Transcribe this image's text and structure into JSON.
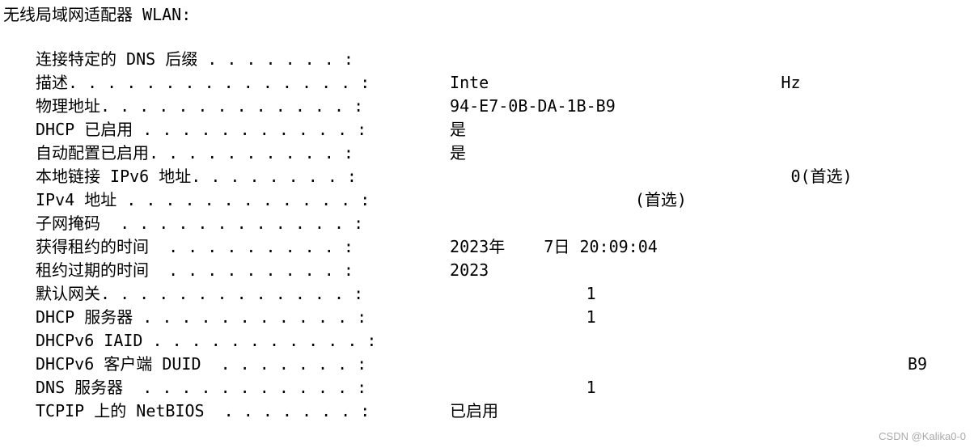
{
  "header": "无线局域网适配器 WLAN:",
  "rows": [
    {
      "label": "连接特定的 DNS 后缀 . . . . . . . :",
      "value": ""
    },
    {
      "label": "描述. . . . . . . . . . . . . . . :",
      "value": " Inte                              Hz"
    },
    {
      "label": "物理地址. . . . . . . . . . . . . :",
      "value": " 94-E7-0B-DA-1B-B9"
    },
    {
      "label": "DHCP 已启用 . . . . . . . . . . . :",
      "value": " 是"
    },
    {
      "label": "自动配置已启用. . . . . . . . . . :",
      "value": " 是"
    },
    {
      "label": "本地链接 IPv6 地址. . . . . . . . :",
      "value": "                                    0(首选)"
    },
    {
      "label": "IPv4 地址 . . . . . . . . . . . . :",
      "value": "                    (首选)"
    },
    {
      "label": "子网掩码  . . . . . . . . . . . . :",
      "value": ""
    },
    {
      "label": "获得租约的时间  . . . . . . . . . :",
      "value": " 2023年    7日 20:09:04"
    },
    {
      "label": "租约过期的时间  . . . . . . . . . :",
      "value": " 2023"
    },
    {
      "label": "默认网关. . . . . . . . . . . . . :",
      "value": "               1"
    },
    {
      "label": "DHCP 服务器 . . . . . . . . . . . :",
      "value": "               1"
    },
    {
      "label": "DHCPv6 IAID . . . . . . . . . . . :",
      "value": ""
    },
    {
      "label": "DHCPv6 客户端 DUID  . . . . . . . :",
      "value": "                                                B9"
    },
    {
      "label": "DNS 服务器  . . . . . . . . . . . :",
      "value": "               1"
    },
    {
      "label": "TCPIP 上的 NetBIOS  . . . . . . . :",
      "value": " 已启用"
    }
  ],
  "watermark": "CSDN @Kalika0-0"
}
